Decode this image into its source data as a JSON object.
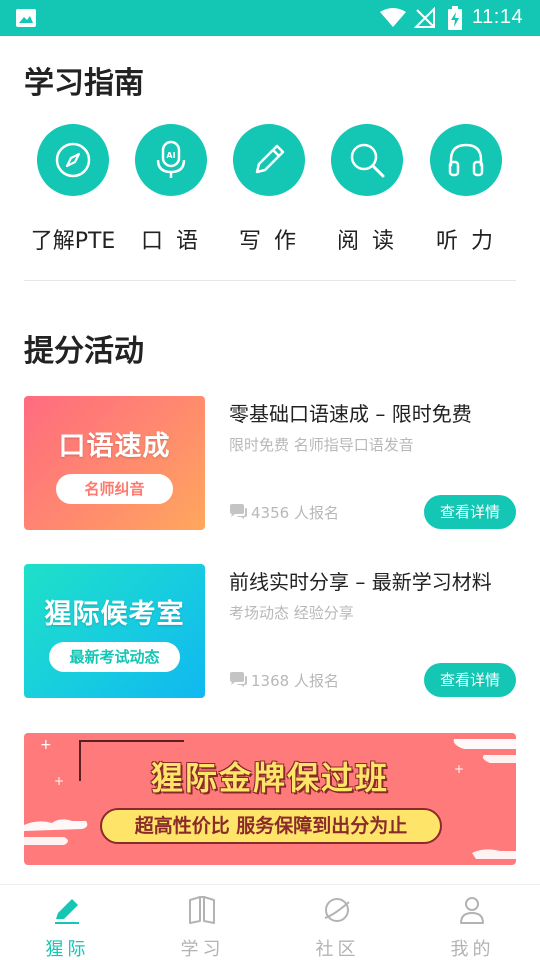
{
  "status_bar": {
    "time": "11:14"
  },
  "guide": {
    "title": "学习指南",
    "items": [
      {
        "label": "了解PTE",
        "icon": "compass-icon"
      },
      {
        "label": "口 语",
        "icon": "microphone-icon"
      },
      {
        "label": "写 作",
        "icon": "pencil-icon"
      },
      {
        "label": "阅 读",
        "icon": "search-icon"
      },
      {
        "label": "听 力",
        "icon": "headphones-icon"
      }
    ]
  },
  "activities": {
    "title": "提分活动",
    "items": [
      {
        "thumb_title": "口语速成",
        "thumb_tag": "名师纠音",
        "title": "零基础口语速成 – 限时免费",
        "subtitle": "限时免费 名师指导口语发音",
        "count": "4356 人报名",
        "button": "查看详情"
      },
      {
        "thumb_title": "猩际候考室",
        "thumb_tag": "最新考试动态",
        "title": "前线实时分享 – 最新学习材料",
        "subtitle": "考场动态 经验分享",
        "count": "1368 人报名",
        "button": "查看详情"
      }
    ]
  },
  "banner": {
    "title": "猩际金牌保过班",
    "tagline": "超高性价比 服务保障到出分为止"
  },
  "tabs": [
    {
      "label": "猩际",
      "icon": "pen-icon",
      "active": true
    },
    {
      "label": "学习",
      "icon": "book-icon",
      "active": false
    },
    {
      "label": "社区",
      "icon": "planet-icon",
      "active": false
    },
    {
      "label": "我的",
      "icon": "person-icon",
      "active": false
    }
  ],
  "colors": {
    "accent": "#14c6b4",
    "banner": "#ff7b7b"
  }
}
